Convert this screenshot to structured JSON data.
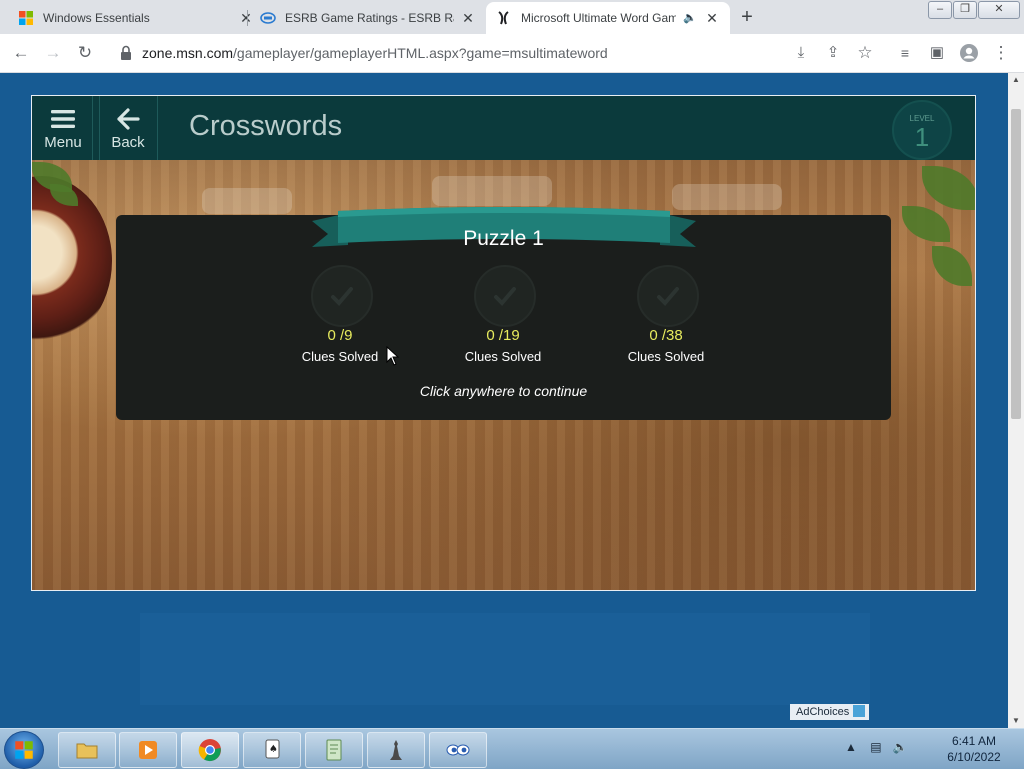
{
  "browser": {
    "tabs": [
      {
        "title": "Windows Essentials",
        "active": false
      },
      {
        "title": "ESRB Game Ratings - ESRB Ratin",
        "active": false
      },
      {
        "title": "Microsoft Ultimate Word Game",
        "active": true
      }
    ],
    "new_tab_symbol": "+",
    "url_host": "zone.msn.com",
    "url_path": "/gameplayer/gameplayerHTML.aspx?game=msultimateword"
  },
  "game": {
    "header": {
      "menu_label": "Menu",
      "back_label": "Back",
      "title": "Crosswords",
      "level_caption": "LEVEL",
      "level_value": "1"
    },
    "results": {
      "puzzle_title": "Puzzle 1",
      "items": [
        {
          "score": "0 /9",
          "label": "Clues Solved"
        },
        {
          "score": "0 /19",
          "label": "Clues Solved"
        },
        {
          "score": "0 /38",
          "label": "Clues Solved"
        }
      ],
      "continue_text": "Click anywhere to continue"
    }
  },
  "ad": {
    "adchoices_label": "AdChoices"
  },
  "taskbar": {
    "time": "6:41 AM",
    "date": "6/10/2022"
  },
  "colors": {
    "page_background": "#175b93",
    "game_header": "#0b3a3c",
    "panel": "#1b1e1c",
    "ribbon": "#1f7f78",
    "score_yellow": "#e8ec5e"
  }
}
